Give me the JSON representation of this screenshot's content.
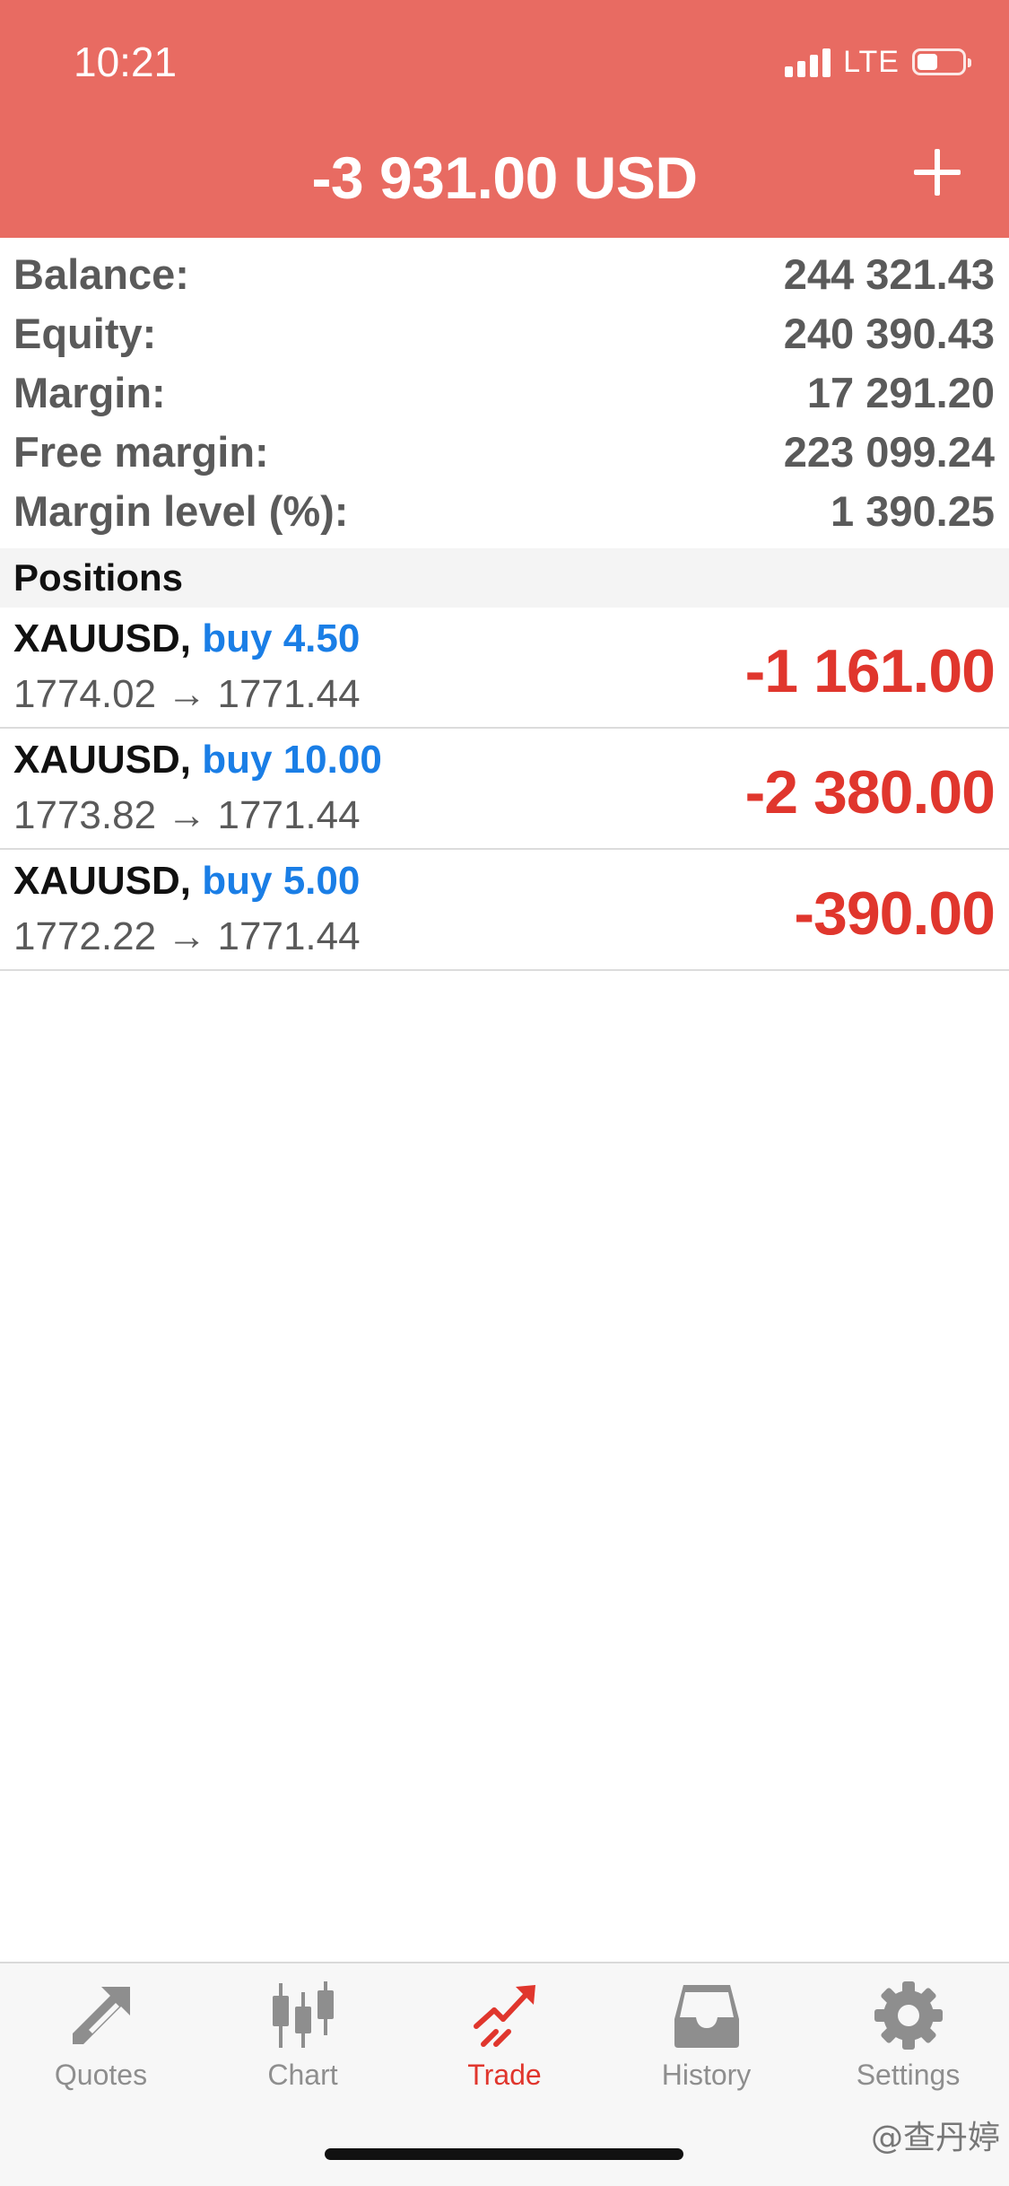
{
  "status_bar": {
    "time": "10:21",
    "network": "LTE"
  },
  "header": {
    "title": "-3 931.00 USD",
    "add_icon": "plus-icon",
    "background": "#e86b62"
  },
  "summary": [
    {
      "label": "Balance:",
      "value": "244 321.43"
    },
    {
      "label": "Equity:",
      "value": "240 390.43"
    },
    {
      "label": "Margin:",
      "value": "17 291.20"
    },
    {
      "label": "Free margin:",
      "value": "223 099.24"
    },
    {
      "label": "Margin level (%):",
      "value": "1 390.25"
    }
  ],
  "positions": {
    "title": "Positions",
    "items": [
      {
        "symbol": "XAUUSD,",
        "type": "buy 4.50",
        "open_price": "1774.02",
        "current_price": "1771.44",
        "profit": "-1 161.00"
      },
      {
        "symbol": "XAUUSD,",
        "type": "buy 10.00",
        "open_price": "1773.82",
        "current_price": "1771.44",
        "profit": "-2 380.00"
      },
      {
        "symbol": "XAUUSD,",
        "type": "buy 5.00",
        "open_price": "1772.22",
        "current_price": "1771.44",
        "profit": "-390.00"
      }
    ],
    "arrow": "→"
  },
  "tabbar": {
    "tabs": [
      {
        "label": "Quotes",
        "icon": "quotes-icon"
      },
      {
        "label": "Chart",
        "icon": "chart-icon"
      },
      {
        "label": "Trade",
        "icon": "trade-icon",
        "active": true
      },
      {
        "label": "History",
        "icon": "history-icon"
      },
      {
        "label": "Settings",
        "icon": "settings-icon"
      }
    ]
  },
  "watermark": "@查丹婷",
  "colors": {
    "accent": "#e0362d",
    "buy": "#1a7ee6",
    "header": "#e86b62"
  }
}
